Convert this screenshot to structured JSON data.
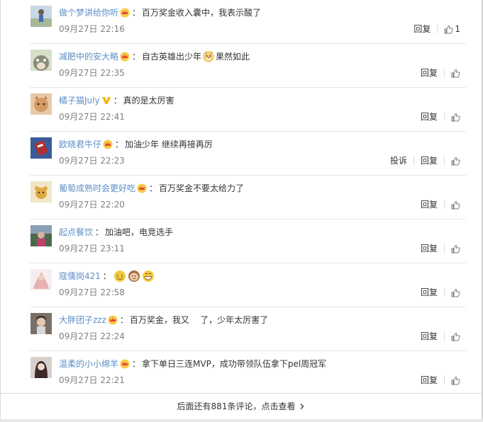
{
  "comments": [
    {
      "user": "做个梦讲给你听",
      "badge": "crown-icon",
      "text": "百万奖金收入囊中，我表示酸了",
      "time": "09月27日 22:16",
      "complaint": "",
      "reply": "回复",
      "likes": "1"
    },
    {
      "user": "减肥中的安大略",
      "badge": "crown-icon",
      "text_before": "自古英雄出少年",
      "emoji": "doge-emoji",
      "text_after": "果然如此",
      "time": "09月27日 22:35",
      "reply": "回复",
      "likes": ""
    },
    {
      "user": "橘子猫July",
      "badge": "verified-v-icon",
      "text": "真的是太厉害",
      "time": "09月27日 22:41",
      "reply": "回复",
      "likes": ""
    },
    {
      "user": "欧晓君牛仔",
      "badge": "crown-icon",
      "text": "加油少年 继续再接再厉",
      "time": "09月27日 22:23",
      "complaint": "投诉",
      "reply": "回复",
      "likes": ""
    },
    {
      "user": "葡萄成熟时会更好吃",
      "badge": "crown-icon",
      "text": "百万奖金不要太给力了",
      "time": "09月27日 22:20",
      "reply": "回复",
      "likes": ""
    },
    {
      "user": "起点餐饮",
      "text": "加油吧，电竞选手",
      "time": "09月27日 23:11",
      "reply": "回复",
      "likes": ""
    },
    {
      "user": "寇儒岗421",
      "emojis": [
        "money-face-emoji",
        "monkey-emoji",
        "grin-emoji"
      ],
      "time": "09月27日 22:58",
      "reply": "回复",
      "likes": ""
    },
    {
      "user": "大胖团子zzz",
      "badge": "crown-icon",
      "text": "百万奖金，我又    了，少年太厉害了",
      "time": "09月27日 22:24",
      "reply": "回复",
      "likes": ""
    },
    {
      "user": "温柔的小小绵羊",
      "badge": "crown-icon",
      "text": "拿下单日三连MVP，成功带领队伍拿下pel周冠军",
      "time": "09月27日 22:21",
      "reply": "回复",
      "likes": ""
    }
  ],
  "footer": {
    "more_text": "后面还有881条评论，点击查看",
    "chevron_icon": "chevron-right-icon"
  },
  "colors": {
    "username": "#5e8ec6",
    "time": "#808080",
    "separator": "#e6e6e6",
    "badge_crown": "#f9a825",
    "badge_v": "#f5b400"
  }
}
